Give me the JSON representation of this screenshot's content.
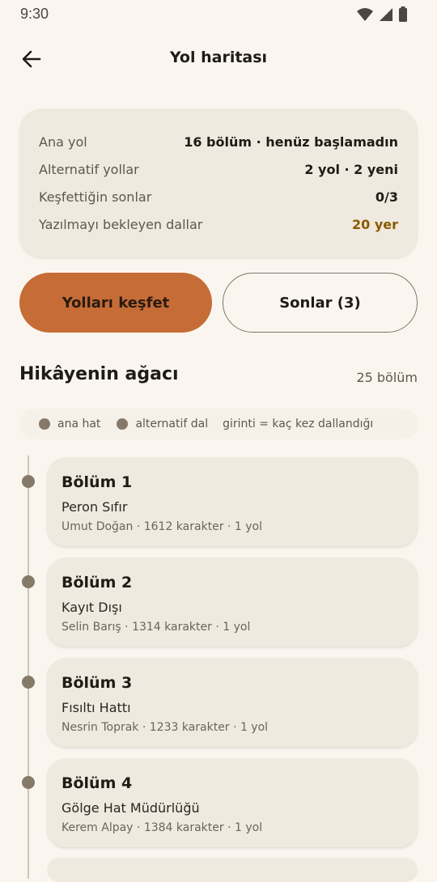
{
  "status_bar": {
    "time": "9:30"
  },
  "app_bar": {
    "title": "Yol haritası"
  },
  "stats": [
    {
      "label": "Ana yol",
      "value": "16 bölüm · henüz başlamadın"
    },
    {
      "label": "Alternatif yollar",
      "value": "2 yol · 2 yeni"
    },
    {
      "label": "Keşfettiğin sonlar",
      "value": "0/3"
    },
    {
      "label": "Yazılmayı bekleyen dallar",
      "value": "20 yer",
      "accent": "#8a5a00"
    }
  ],
  "buttons": {
    "explore": "Yolları keşfet",
    "endings": "Sonlar (3)"
  },
  "section": {
    "title": "Hikâyenin ağacı",
    "count": "25 bölüm"
  },
  "legend": {
    "main": "ana hat",
    "alt": "alternatif dal",
    "note": "girinti = kaç kez dallandığı"
  },
  "chapters": [
    {
      "num": "Bölüm 1",
      "title": "Peron Sıfır",
      "meta": "Umut Doğan · 1612 karakter · 1 yol"
    },
    {
      "num": "Bölüm 2",
      "title": "Kayıt Dışı",
      "meta": "Selin Barış · 1314 karakter · 1 yol"
    },
    {
      "num": "Bölüm 3",
      "title": "Fısıltı Hattı",
      "meta": "Nesrin Toprak · 1233 karakter · 1 yol"
    },
    {
      "num": "Bölüm 4",
      "title": "Gölge Hat Müdürlüğü",
      "meta": "Kerem Alpay · 1384 karakter · 1 yol"
    }
  ],
  "colors": {
    "primary": "#c56c37",
    "background": "#faf6ef",
    "card": "#efe9df",
    "dot": "#857a6a"
  }
}
